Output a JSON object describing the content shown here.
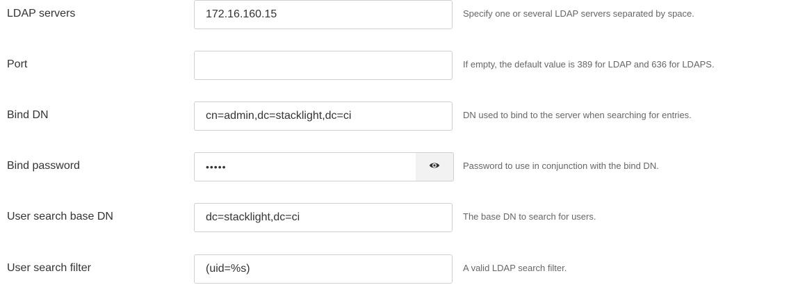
{
  "fields": [
    {
      "label": "LDAP servers",
      "value": "172.16.160.15",
      "help": "Specify one or several LDAP servers separated by space."
    },
    {
      "label": "Port",
      "value": "",
      "help": "If empty, the default value is 389 for LDAP and 636 for LDAPS."
    },
    {
      "label": "Bind DN",
      "value": "cn=admin,dc=stacklight,dc=ci",
      "help": "DN used to bind to the server when searching for entries."
    },
    {
      "label": "Bind password",
      "value": "•••••",
      "help": "Password to use in conjunction with the bind DN.",
      "reveal_icon": "eye-icon"
    },
    {
      "label": "User search base DN",
      "value": "dc=stacklight,dc=ci",
      "help": "The base DN to search for users."
    },
    {
      "label": "User search filter",
      "value": "(uid=%s)",
      "help": "A valid LDAP search filter."
    }
  ]
}
